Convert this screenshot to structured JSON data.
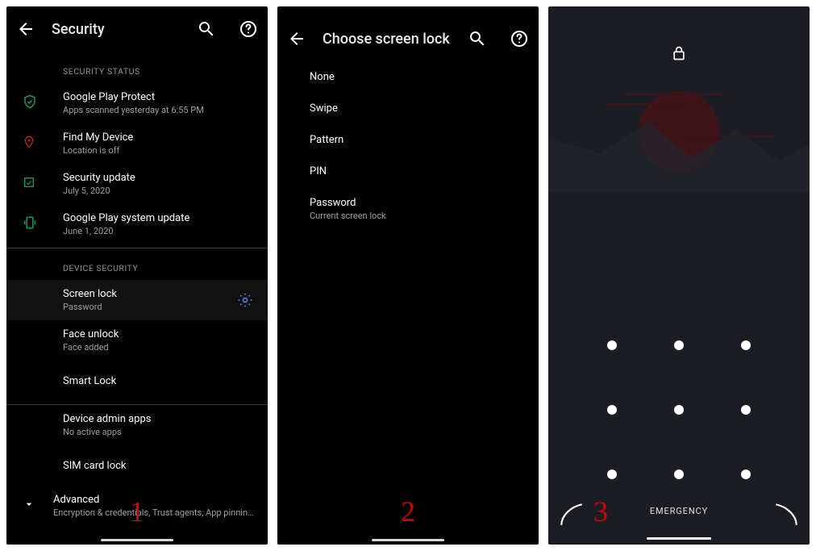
{
  "step_labels": [
    "1",
    "2",
    "3"
  ],
  "s1": {
    "title": "Security",
    "sections": {
      "status_label": "SECURITY STATUS",
      "device_label": "DEVICE SECURITY"
    },
    "rows": {
      "play_protect": {
        "label": "Google Play Protect",
        "sub": "Apps scanned yesterday at 6:55 PM"
      },
      "find_device": {
        "label": "Find My Device",
        "sub": "Location is off"
      },
      "sec_update": {
        "label": "Security update",
        "sub": "July 5, 2020"
      },
      "sys_update": {
        "label": "Google Play system update",
        "sub": "June 1, 2020"
      },
      "screen_lock": {
        "label": "Screen lock",
        "sub": "Password"
      },
      "face_unlock": {
        "label": "Face unlock",
        "sub": "Face added"
      },
      "smart_lock": {
        "label": "Smart Lock"
      },
      "admin_apps": {
        "label": "Device admin apps",
        "sub": "No active apps"
      },
      "sim_lock": {
        "label": "SIM card lock"
      },
      "advanced": {
        "label": "Advanced",
        "sub": "Encryption & credentials, Trust agents, App pinning, Confirm SIM…"
      }
    }
  },
  "s2": {
    "title": "Choose screen lock",
    "options": {
      "none": {
        "label": "None"
      },
      "swipe": {
        "label": "Swipe"
      },
      "pattern": {
        "label": "Pattern"
      },
      "pin": {
        "label": "PIN"
      },
      "password": {
        "label": "Password",
        "sub": "Current screen lock"
      }
    }
  },
  "s3": {
    "emergency": "EMERGENCY"
  }
}
